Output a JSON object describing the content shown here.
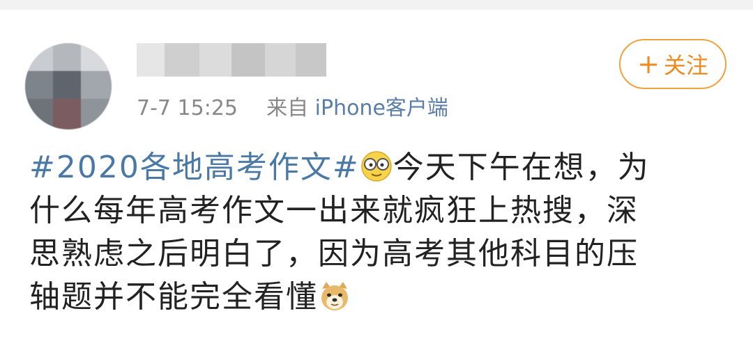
{
  "post": {
    "meta_time": "7-7 15:25",
    "meta_from": "来自",
    "meta_source": "iPhone客户端",
    "follow_label": "关注",
    "follow_plus": "+",
    "hashtag": "#2020各地高考作文#",
    "content_line1": "今天下午在想，为",
    "content_line2": "什么每年高考作文一出来就疯狂上热搜，深",
    "content_line3": "思熟虑之后明白了，因为高考其他科目的压",
    "content_line4": "轴题并不能完全看懂"
  },
  "icons": {
    "emoji_1": "glasses-smile-emoji",
    "emoji_2": "doge-emoji"
  },
  "colors": {
    "hashtag": "#4b79a6",
    "follow_accent": "#f08a1c",
    "meta_text": "#888888",
    "body_text": "#222222"
  }
}
